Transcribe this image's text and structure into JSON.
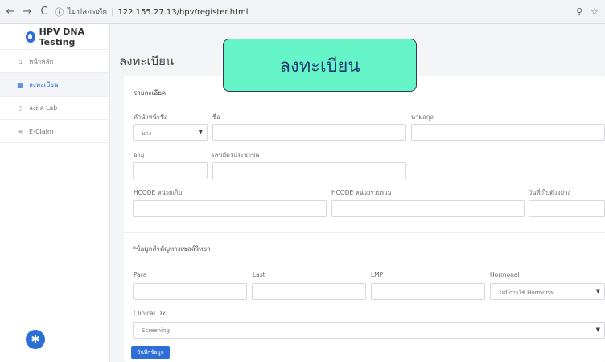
{
  "browser": {
    "back": "←",
    "forward": "→",
    "reload": "C",
    "security_label": "ไม่ปลอดภัย",
    "url": "122.155.27.13/hpv/register.html"
  },
  "sidebar": {
    "brand": "HPV DNA Testing",
    "items": [
      {
        "label": "หน้าหลัก",
        "icon": "home-icon"
      },
      {
        "label": "ลงทะเบียน",
        "icon": "table-icon"
      },
      {
        "label": "ลงผล Lab",
        "icon": "file-icon"
      },
      {
        "label": "E-Claim",
        "icon": "list-icon"
      }
    ]
  },
  "page": {
    "title": "ลงทะเบียน",
    "overlay_title": "ลงทะเบียน",
    "card_header": "รายละเอียด"
  },
  "form": {
    "prefix_label": "คำนำหน้าชื่อ",
    "prefix_value": "นาง",
    "first_name_label": "ชื่อ",
    "last_name_label": "นามสกุล",
    "age_label": "อายุ",
    "id_label": "เลขบัตรประชาชน",
    "hcode_collect_label": "HCODE หน่วยเก็บ",
    "hcode_gather_label": "HCODE หน่วยรวบรวม",
    "collect_date_label": "วันที่เก็บตัวอย่าง",
    "medical_section": "*ข้อมูลสำคัญทางเซลล์วิทยา",
    "para_label": "Para",
    "last_label": "Last",
    "lmp_label": "LMP",
    "hormonal_label": "Hormonal",
    "hormonal_value": "ไม่มีการใช้ Hormonal",
    "clinical_label": "Clinical Dx.",
    "clinical_value": "Screening",
    "save_button": "บันทึกข้อมูล"
  },
  "colors": {
    "primary": "#2d6fd6",
    "overlay_bg": "#66f5c8",
    "overlay_text": "#1f3870"
  }
}
